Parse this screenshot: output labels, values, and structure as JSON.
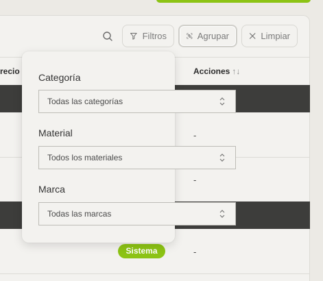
{
  "toolbar": {
    "search_icon": "search-icon",
    "filtros_label": "Filtros",
    "agrupar_label": "Agrupar",
    "limpiar_label": "Limpiar"
  },
  "table": {
    "headers": {
      "precio": "recio",
      "acciones": "Acciones",
      "acciones_sort": "↑↓"
    },
    "rows": [
      {
        "accion": "-"
      },
      {
        "accion": "-"
      },
      {
        "accion": "-",
        "badge": "Sistema"
      }
    ]
  },
  "filters": {
    "categoria": {
      "label": "Categoría",
      "selected": "Todas las categorías"
    },
    "material": {
      "label": "Material",
      "selected": "Todos los materiales"
    },
    "marca": {
      "label": "Marca",
      "selected": "Todas las marcas"
    }
  },
  "colors": {
    "accent_green": "#8cc314",
    "dark_row": "#3d3d3b",
    "panel_bg": "#f3f2ef"
  }
}
